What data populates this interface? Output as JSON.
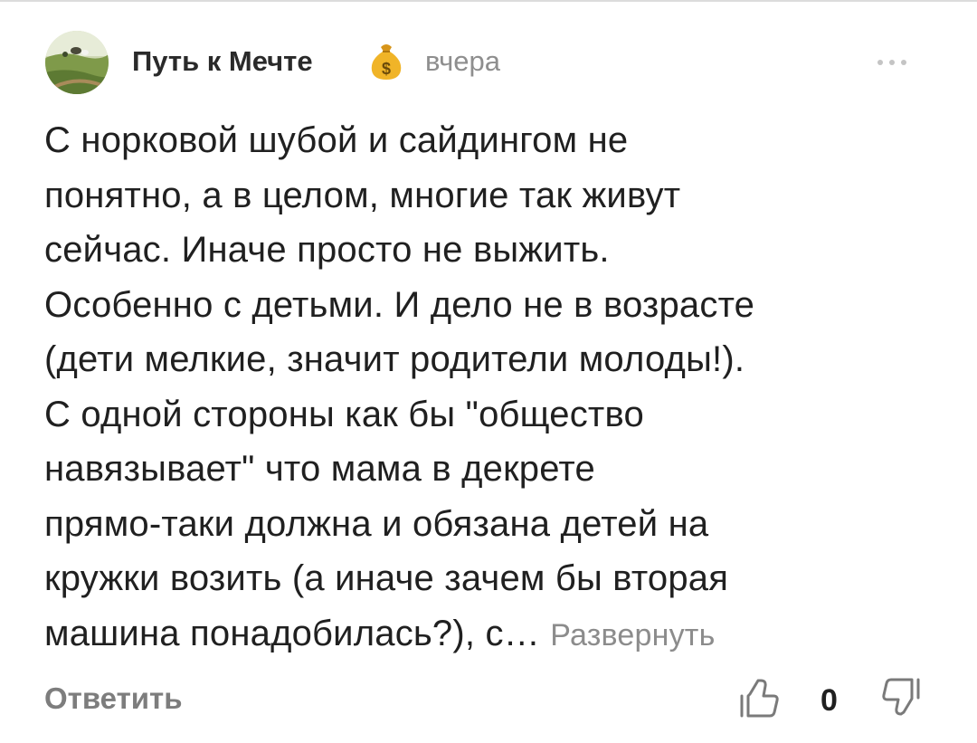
{
  "comment": {
    "author": {
      "name": "Путь к Мечте",
      "badge_icon": "money-bag-icon",
      "badge_symbol": "$",
      "avatar_icon": "landscape-photo-avatar"
    },
    "timestamp": "вчера",
    "more_icon": "more-dots-icon",
    "text": "С норковой шубой и сайдингом не\nпонятно, а в целом, многие так живут\nсейчас. Иначе просто не выжить.\nОсобенно с детьми. И дело не в возрасте\n(дети мелкие, значит родители молоды!).\nС одной стороны как бы \"общество\nнавязывает\" что мама в декрете\nпрямо-таки должна и обязана детей на\nкружки возить (а иначе зачем бы вторая\nмашина понадобилась?), с… ",
    "expand_label": "Развернуть"
  },
  "actions": {
    "reply_label": "Ответить",
    "like_icon": "thumbs-up-icon",
    "like_count": "0",
    "dislike_icon": "thumbs-down-icon"
  },
  "colors": {
    "text": "#202020",
    "muted": "#8e8e8e",
    "badge": "#e6a520"
  }
}
